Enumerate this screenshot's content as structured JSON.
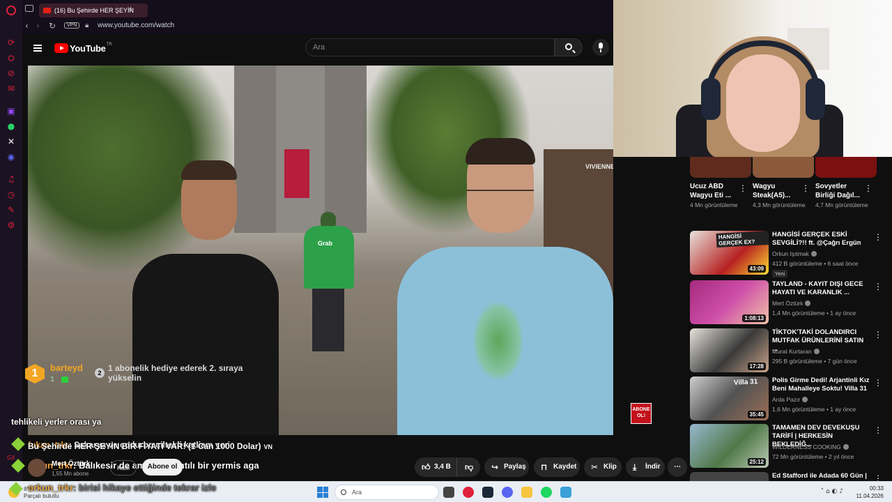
{
  "browser": {
    "tab_title": "(16) Bu Şehirde HER ŞEYİN",
    "url": "www.youtube.com/watch",
    "vpn_label": "VPN"
  },
  "youtube": {
    "logo_text": "YouTube",
    "region": "TR",
    "search_placeholder": "Ara"
  },
  "video_overlay": {
    "gift_rank": "1",
    "gift_user": "barteyd",
    "gift_count": "1",
    "gift_position": "2",
    "gift_message": "1 abonelik hediye ederek 2. sıraya yükselin",
    "chat_line1": "tehlikeli yerler orası ya",
    "title_overlay": "Bu Şehirde HER ŞEYİN BİR FİYATI VAR! (1 Can 1000 Dolar)",
    "title_overlay_suffix": "VN",
    "chat_line2_user": "fukan_trkr",
    "chat_line2_text": ": Sakarya ve çodurbu çiltekli katliam yeri",
    "chat_line3_user": "orkun_trkr",
    "chat_line3_text": ": Balıkesir de ama ileri kıntılı bir yermis aga",
    "chat_line4_user": "orkun_trkr",
    "chat_line4_text": ": birisi hikaye ettiğinde tekrar izle",
    "abone_badge": "ABONE OL!",
    "grab_text": "Grab",
    "shop_sign": "VIVIENNE"
  },
  "channel": {
    "name": "Mert Öztürk",
    "subscribers": "1,55 Mn abone",
    "join_label": "Katıl",
    "subscribe_label": "Abone ol"
  },
  "actions": {
    "like_count": "3,4 B",
    "share_label": "Paylaş",
    "save_label": "Kaydet",
    "clip_label": "Klip",
    "download_label": "İndir"
  },
  "shorts": [
    {
      "title": "Ucuz ABD Wagyu Eti ...",
      "views": "4 Mn görüntüleme"
    },
    {
      "title": "Wagyu Steak(A5)...",
      "views": "4,3 Mn görüntüleme"
    },
    {
      "title": "Sovyetler Birliği Dağıl...",
      "views": "4,7 Mn görüntüleme"
    }
  ],
  "recommendations": [
    {
      "title": "HANGİSİ GERÇEK ESKİ SEVGİLİ?!! ft. @Çağrı Ergün",
      "channel": "Orkun Işıtmak",
      "meta": "412 B görüntüleme • 6 saat önce",
      "duration": "43:09",
      "badge": "Yeni",
      "thumb_text": "HANGİSİ GERÇEK EX?"
    },
    {
      "title": "TAYLAND - KAYIT DIŞI GECE HAYATI VE KARANLIK ...",
      "channel": "Mert Öztürk",
      "meta": "1,4 Mn görüntüleme • 1 ay önce",
      "duration": "1:08:13"
    },
    {
      "title": "TİKTOK'TAKİ DOLANDIRCI MUTFAK ÜRÜNLERİNİ SATIN ...",
      "channel": "Murat Kurtaran",
      "meta": "295 B görüntüleme • 7 gün önce",
      "duration": "17:28"
    },
    {
      "title": "Polis Girme Dedi! Arjantinli Kız Beni Mahalleye Soktu! Villa 31",
      "channel": "Arda Pazır",
      "meta": "1,6 Mn görüntüleme • 1 ay önce",
      "duration": "35:45",
      "thumb_text": "Villa 31"
    },
    {
      "title": "TAMAMEN DEV DEVEKUŞU TARİFİ | HERKESİN BEKLEDİĞ...",
      "channel": "WILDERNESS COOKING",
      "meta": "72 Mn görüntüleme • 2 yıl önce",
      "duration": "25:12"
    },
    {
      "title": "Ed Stafford ile Adada 60 Gün |",
      "channel": "",
      "meta": "",
      "duration": ""
    }
  ],
  "taskbar": {
    "temperature": "8°C",
    "weather": "Parçalı bulutlu",
    "search_placeholder": "Ara",
    "time": "00:33",
    "date": "11.04.2026"
  }
}
